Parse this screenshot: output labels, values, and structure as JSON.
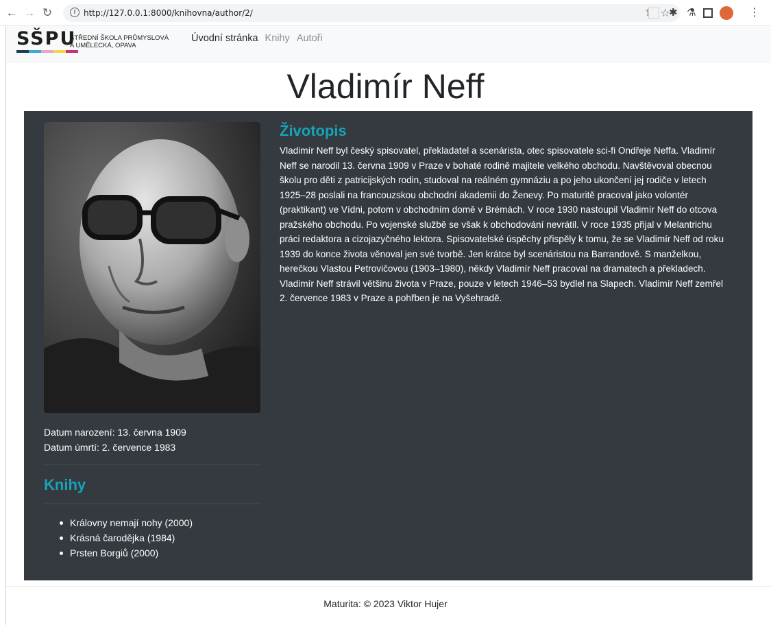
{
  "browser": {
    "url": "http://127.0.0.1:8000/knihovna/author/2/"
  },
  "site": {
    "logo_text": "SŠPU",
    "logo_subtitle_line1": "STŘEDNÍ ŠKOLA PRŮMYSLOVÁ",
    "logo_subtitle_line2": "A UMĚLECKÁ, OPAVA",
    "logo_bar_colors": [
      "#1f3b4d",
      "#3aa9d6",
      "#e7a6c3",
      "#f3d64b",
      "#cc2f7a"
    ],
    "nav": [
      {
        "label": "Úvodní stránka",
        "active": true
      },
      {
        "label": "Knihy",
        "active": false
      },
      {
        "label": "Autoři",
        "active": false
      }
    ]
  },
  "author": {
    "first_name": "Vladimír",
    "last_name": "Neff",
    "birth": "Datum narození: 13. června 1909",
    "death": "Datum úmrtí: 2. července 1983",
    "bio_heading": "Životopis",
    "bio": "Vladimír Neff byl český spisovatel, překladatel a scenárista, otec spisovatele sci-fi Ondřeje Neffa. Vladimír Neff se narodil 13. června 1909 v Praze v bohaté rodině majitele velkého obchodu. Navštěvoval obecnou školu pro děti z patricijských rodin, studoval na reálném gymnáziu a po jeho ukončení jej rodiče v letech 1925–28 poslali na francouzskou obchodní akademii do Ženevy. Po maturitě pracoval jako volontér (praktikant) ve Vídni, potom v obchodním domě v Brémách. V roce 1930 nastoupil Vladimír Neff do otcova pražského obchodu. Po vojenské službě se však k obchodování nevrátil. V roce 1935 přijal v Melantrichu práci redaktora a cizojazyčného lektora. Spisovatelské úspěchy přispěly k tomu, že se Vladimír Neff od roku 1939 do konce života věnoval jen své tvorbě. Jen krátce byl scenáristou na Barrandově. S manželkou, herečkou Vlastou Petrovičovou (1903–1980), někdy Vladimír Neff pracoval na dramatech a překladech. Vladimír Neff strávil většinu života v Praze, pouze v letech 1946–53 bydlel na Slapech. Vladimír Neff zemřel 2. července 1983 v Praze a pohřben je na Vyšehradě.",
    "books_heading": "Knihy",
    "books": [
      "Královny nemají nohy (2000)",
      "Krásná čarodějka (1984)",
      "Prsten Borgiů (2000)"
    ]
  },
  "footer": {
    "text": "Maturita: © 2023 Viktor Hujer"
  },
  "colors": {
    "panel_bg": "#343a40",
    "accent": "#17a2b8",
    "header_bg": "#f8f9fa"
  }
}
